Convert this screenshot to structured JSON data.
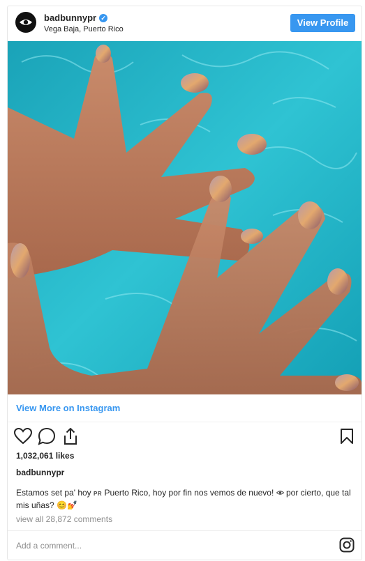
{
  "post": {
    "username": "badbunnypr",
    "location": "Vega Baja, Puerto Rico",
    "view_profile_label": "View Profile",
    "view_more_label": "View More on Instagram",
    "likes": "1,032,061 likes",
    "caption_owner": "badbunnypr",
    "caption_part1": "Estamos set pa' hoy",
    "caption_flag": "PR",
    "caption_part2": "Puerto Rico, hoy por fin nos vemos de nuevo!",
    "caption_part3": "por cierto, que tal mis uñas?",
    "caption_emojis": "😊💅",
    "view_comments": "view all 28,872 comments",
    "add_comment_placeholder": "Add a comment..."
  },
  "colors": {
    "accent": "#3897f0",
    "text": "#262626",
    "muted": "#8e8e8e",
    "water": "#22b5c8"
  },
  "icons": [
    "eye-icon",
    "verified-icon",
    "heart-icon",
    "comment-icon",
    "share-icon",
    "bookmark-icon",
    "instagram-icon"
  ]
}
